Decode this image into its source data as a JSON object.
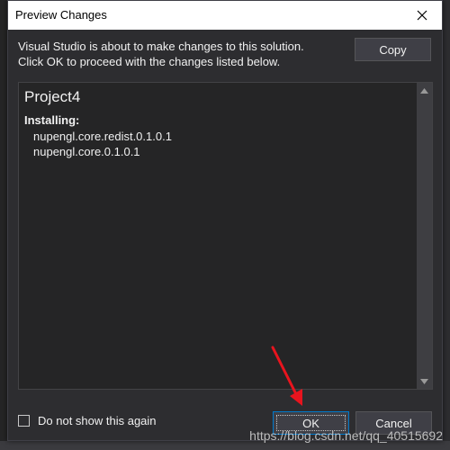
{
  "dialog": {
    "title": "Preview Changes",
    "description_line1": "Visual Studio is about to make changes to this solution.",
    "description_line2": "Click OK to proceed with the changes listed below.",
    "copy_label": "Copy",
    "project_name": "Project4",
    "installing_label": "Installing:",
    "packages": [
      "nupengl.core.redist.0.1.0.1",
      "nupengl.core.0.1.0.1"
    ],
    "checkbox_label": "Do not show this again",
    "checkbox_checked": false,
    "ok_label": "OK",
    "cancel_label": "Cancel"
  },
  "icons": {
    "close": "close-icon",
    "scroll_up": "scroll-up-arrow-icon",
    "scroll_down": "scroll-down-arrow-icon",
    "annotation": "red-arrow-icon"
  },
  "colors": {
    "dialog_bg": "#2d2d30",
    "panel_bg": "#252526",
    "text": "#f1f1f1",
    "accent": "#007acc",
    "annotation": "#e8141e"
  },
  "watermark": "https://blog.csdn.net/qq_40515692"
}
